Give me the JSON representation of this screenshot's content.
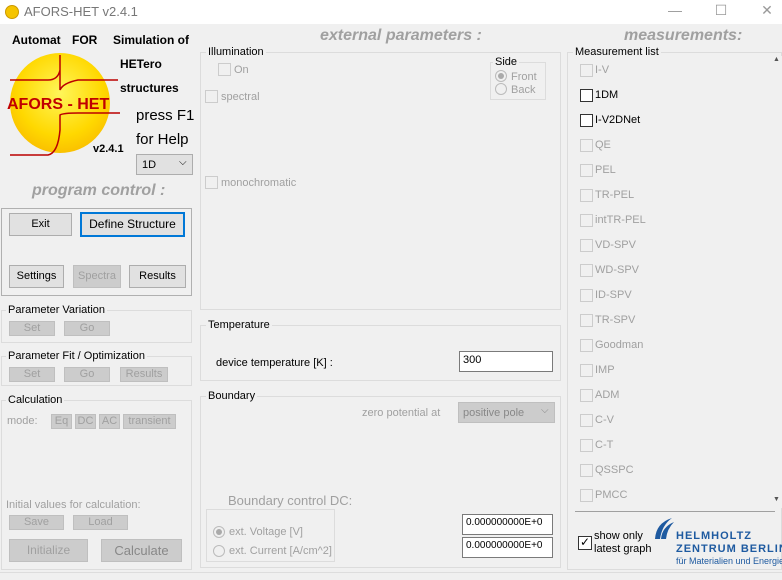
{
  "window": {
    "title": "AFORS-HET v2.4.1",
    "minimize": "—",
    "maximize": "☐",
    "close": "✕"
  },
  "left": {
    "automat": "Automat",
    "for": "FOR",
    "simulation": "Simulation of",
    "hetero": "HETero",
    "structures": "structures",
    "logo_text": "AFORS - HET",
    "version": "v2.4.1",
    "press_f1": "press F1",
    "for_help": "for Help",
    "dimension": "1D",
    "program_control": "program control :",
    "exit": "Exit",
    "define_structure": "Define Structure",
    "settings": "Settings",
    "spectra": "Spectra",
    "results": "Results",
    "param_variation": "Parameter Variation",
    "pv_set": "Set",
    "pv_go": "Go",
    "param_fit": "Parameter Fit / Optimization",
    "pf_set": "Set",
    "pf_go": "Go",
    "pf_results": "Results",
    "calculation": "Calculation",
    "mode": "mode:",
    "eq": "Eq",
    "dc": "DC",
    "ac": "AC",
    "transient": "transient",
    "initial_values": "Initial values for calculation:",
    "save": "Save",
    "load": "Load",
    "initialize": "Initialize",
    "calculate": "Calculate"
  },
  "center": {
    "header": "external parameters :",
    "illumination": "Illumination",
    "on": "On",
    "spectral": "spectral",
    "monochromatic": "monochromatic",
    "side": "Side",
    "front": "Front",
    "back": "Back",
    "temperature": "Temperature",
    "device_temp_label": "device temperature [K] :",
    "device_temp": "300",
    "boundary": "Boundary",
    "zero_potential": "zero potential at",
    "zero_potential_value": "positive pole",
    "boundary_dc": "Boundary control DC:",
    "ext_voltage": "ext. Voltage [V]",
    "ext_current": "ext. Current [A/cm^2]",
    "voltage_value": "0.000000000E+0",
    "current_value": "0.000000000E+0"
  },
  "right": {
    "header": "measurements:",
    "list_label": "Measurement list",
    "items": [
      {
        "label": "I-V",
        "enabled": false
      },
      {
        "label": "1DM",
        "enabled": true
      },
      {
        "label": "I-V2DNet",
        "enabled": true
      },
      {
        "label": "QE",
        "enabled": false
      },
      {
        "label": "PEL",
        "enabled": false
      },
      {
        "label": "TR-PEL",
        "enabled": false
      },
      {
        "label": "intTR-PEL",
        "enabled": false
      },
      {
        "label": "VD-SPV",
        "enabled": false
      },
      {
        "label": "WD-SPV",
        "enabled": false
      },
      {
        "label": "ID-SPV",
        "enabled": false
      },
      {
        "label": "TR-SPV",
        "enabled": false
      },
      {
        "label": "Goodman",
        "enabled": false
      },
      {
        "label": "IMP",
        "enabled": false
      },
      {
        "label": "ADM",
        "enabled": false
      },
      {
        "label": "C-V",
        "enabled": false
      },
      {
        "label": "C-T",
        "enabled": false
      },
      {
        "label": "QSSPC",
        "enabled": false
      },
      {
        "label": "PMCC",
        "enabled": false
      }
    ],
    "show_only": "show only",
    "latest_graph": "latest graph",
    "hzb1": "HELMHOLTZ",
    "hzb2": "ZENTRUM BERLIN",
    "hzb3": "für Materialien und Energie"
  }
}
